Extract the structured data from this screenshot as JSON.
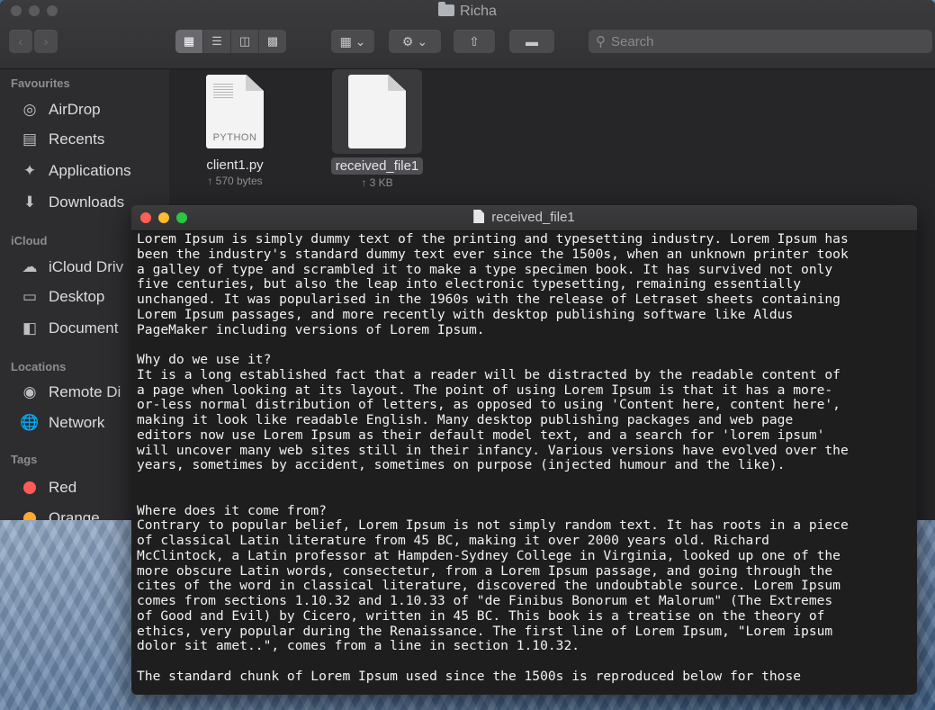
{
  "finder": {
    "title": "Richa",
    "search_placeholder": "Search",
    "sidebar": {
      "favourites_heading": "Favourites",
      "favourites": [
        {
          "label": "AirDrop",
          "icon": "airdrop-icon"
        },
        {
          "label": "Recents",
          "icon": "recents-icon"
        },
        {
          "label": "Applications",
          "icon": "applications-icon"
        },
        {
          "label": "Downloads",
          "icon": "downloads-icon"
        }
      ],
      "icloud_heading": "iCloud",
      "icloud": [
        {
          "label": "iCloud Driv",
          "icon": "cloud-icon"
        },
        {
          "label": "Desktop",
          "icon": "desktop-icon"
        },
        {
          "label": "Document",
          "icon": "documents-icon"
        }
      ],
      "locations_heading": "Locations",
      "locations": [
        {
          "label": "Remote Di",
          "icon": "disc-icon"
        },
        {
          "label": "Network",
          "icon": "network-icon"
        }
      ],
      "tags_heading": "Tags",
      "tags": [
        {
          "label": "Red",
          "color": "#ff5b57"
        },
        {
          "label": "Orange",
          "color": "#ffab2e"
        }
      ]
    },
    "files": [
      {
        "name": "client1.py",
        "size": "↑ 570 bytes",
        "type_tag": "PYTHON"
      },
      {
        "name": "received_file1",
        "size": "↑ 3 KB",
        "type_tag": ""
      }
    ]
  },
  "editor": {
    "title": "received_file1",
    "lines": [
      "Lorem Ipsum is simply dummy text of the printing and typesetting industry. Lorem Ipsum has",
      "been the industry's standard dummy text ever since the 1500s, when an unknown printer took",
      "a galley of type and scrambled it to make a type specimen book. It has survived not only",
      "five centuries, but also the leap into electronic typesetting, remaining essentially",
      "unchanged. It was popularised in the 1960s with the release of Letraset sheets containing",
      "Lorem Ipsum passages, and more recently with desktop publishing software like Aldus",
      "PageMaker including versions of Lorem Ipsum.",
      "",
      "Why do we use it?",
      "It is a long established fact that a reader will be distracted by the readable content of",
      "a page when looking at its layout. The point of using Lorem Ipsum is that it has a more-",
      "or-less normal distribution of letters, as opposed to using 'Content here, content here',",
      "making it look like readable English. Many desktop publishing packages and web page",
      "editors now use Lorem Ipsum as their default model text, and a search for 'lorem ipsum'",
      "will uncover many web sites still in their infancy. Various versions have evolved over the",
      "years, sometimes by accident, sometimes on purpose (injected humour and the like).",
      "",
      "",
      "Where does it come from?",
      "Contrary to popular belief, Lorem Ipsum is not simply random text. It has roots in a piece",
      "of classical Latin literature from 45 BC, making it over 2000 years old. Richard",
      "McClintock, a Latin professor at Hampden-Sydney College in Virginia, looked up one of the",
      "more obscure Latin words, consectetur, from a Lorem Ipsum passage, and going through the",
      "cites of the word in classical literature, discovered the undoubtable source. Lorem Ipsum",
      "comes from sections 1.10.32 and 1.10.33 of \"de Finibus Bonorum et Malorum\" (The Extremes",
      "of Good and Evil) by Cicero, written in 45 BC. This book is a treatise on the theory of",
      "ethics, very popular during the Renaissance. The first line of Lorem Ipsum, \"Lorem ipsum",
      "dolor sit amet..\", comes from a line in section 1.10.32.",
      "",
      "The standard chunk of Lorem Ipsum used since the 1500s is reproduced below for those"
    ]
  },
  "colors": {
    "close": "#ff5f57",
    "minimize": "#febc2e",
    "zoom": "#28c840"
  }
}
